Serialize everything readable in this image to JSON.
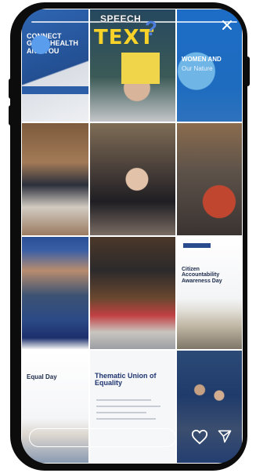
{
  "story": {
    "overlay_title": "SPEECH",
    "text_badge": "TEXT",
    "tiles": [
      {
        "name": "tile-1",
        "headline": "CONNECT GOOD HEALTH AND YOU",
        "sub": ""
      },
      {
        "name": "tile-2",
        "headline": "",
        "sub": ""
      },
      {
        "name": "tile-3",
        "headline": "WOMEN AND",
        "sub": "Our Nature"
      },
      {
        "name": "tile-4",
        "headline": "",
        "sub": ""
      },
      {
        "name": "tile-5",
        "headline": "",
        "sub": ""
      },
      {
        "name": "tile-6",
        "headline": "",
        "sub": ""
      },
      {
        "name": "tile-7",
        "headline": "",
        "sub": ""
      },
      {
        "name": "tile-8",
        "headline": "",
        "sub": ""
      },
      {
        "name": "tile-9",
        "headline": "Citizen Accountability Awareness Day",
        "sub": ""
      },
      {
        "name": "tile-10",
        "headline": "Equal Day",
        "sub": ""
      },
      {
        "name": "tile-11",
        "headline": "Thematic Union of Equality",
        "sub": ""
      },
      {
        "name": "tile-12",
        "headline": "",
        "sub": ""
      }
    ]
  },
  "reply": {
    "placeholder": ""
  },
  "colors": {
    "accent": "#5a9ded",
    "badge": "#f7d229",
    "frame": "#0c0c0c"
  }
}
